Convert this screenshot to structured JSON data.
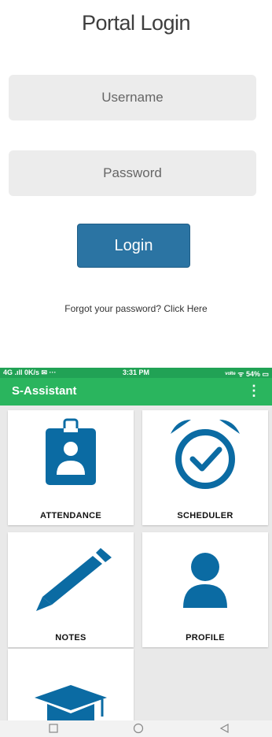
{
  "login": {
    "title": "Portal Login",
    "username_placeholder": "Username",
    "password_placeholder": "Password",
    "login_label": "Login",
    "forgot_text": "Forgot your password? Click Here"
  },
  "status_bar": {
    "left": "4G .ıll 0K/s ✉ ···",
    "time": "3:31 PM",
    "right": "ᵛᵒˡᵗᵉ ᯤ 54% ▭"
  },
  "app_bar": {
    "title": "S-Assistant",
    "menu_icon": "⋮"
  },
  "tiles": [
    {
      "label": "ATTENDANCE",
      "icon": "id-badge-icon"
    },
    {
      "label": "SCHEDULER",
      "icon": "alarm-clock-check-icon"
    },
    {
      "label": "NOTES",
      "icon": "pencil-icon"
    },
    {
      "label": "PROFILE",
      "icon": "person-icon"
    },
    {
      "label": "",
      "icon": "graduation-cap-icon"
    }
  ],
  "colors": {
    "status_bar": "#21a255",
    "app_bar": "#2ab55e",
    "icon_blue": "#0b6ba3",
    "login_button": "#2b74a3"
  }
}
